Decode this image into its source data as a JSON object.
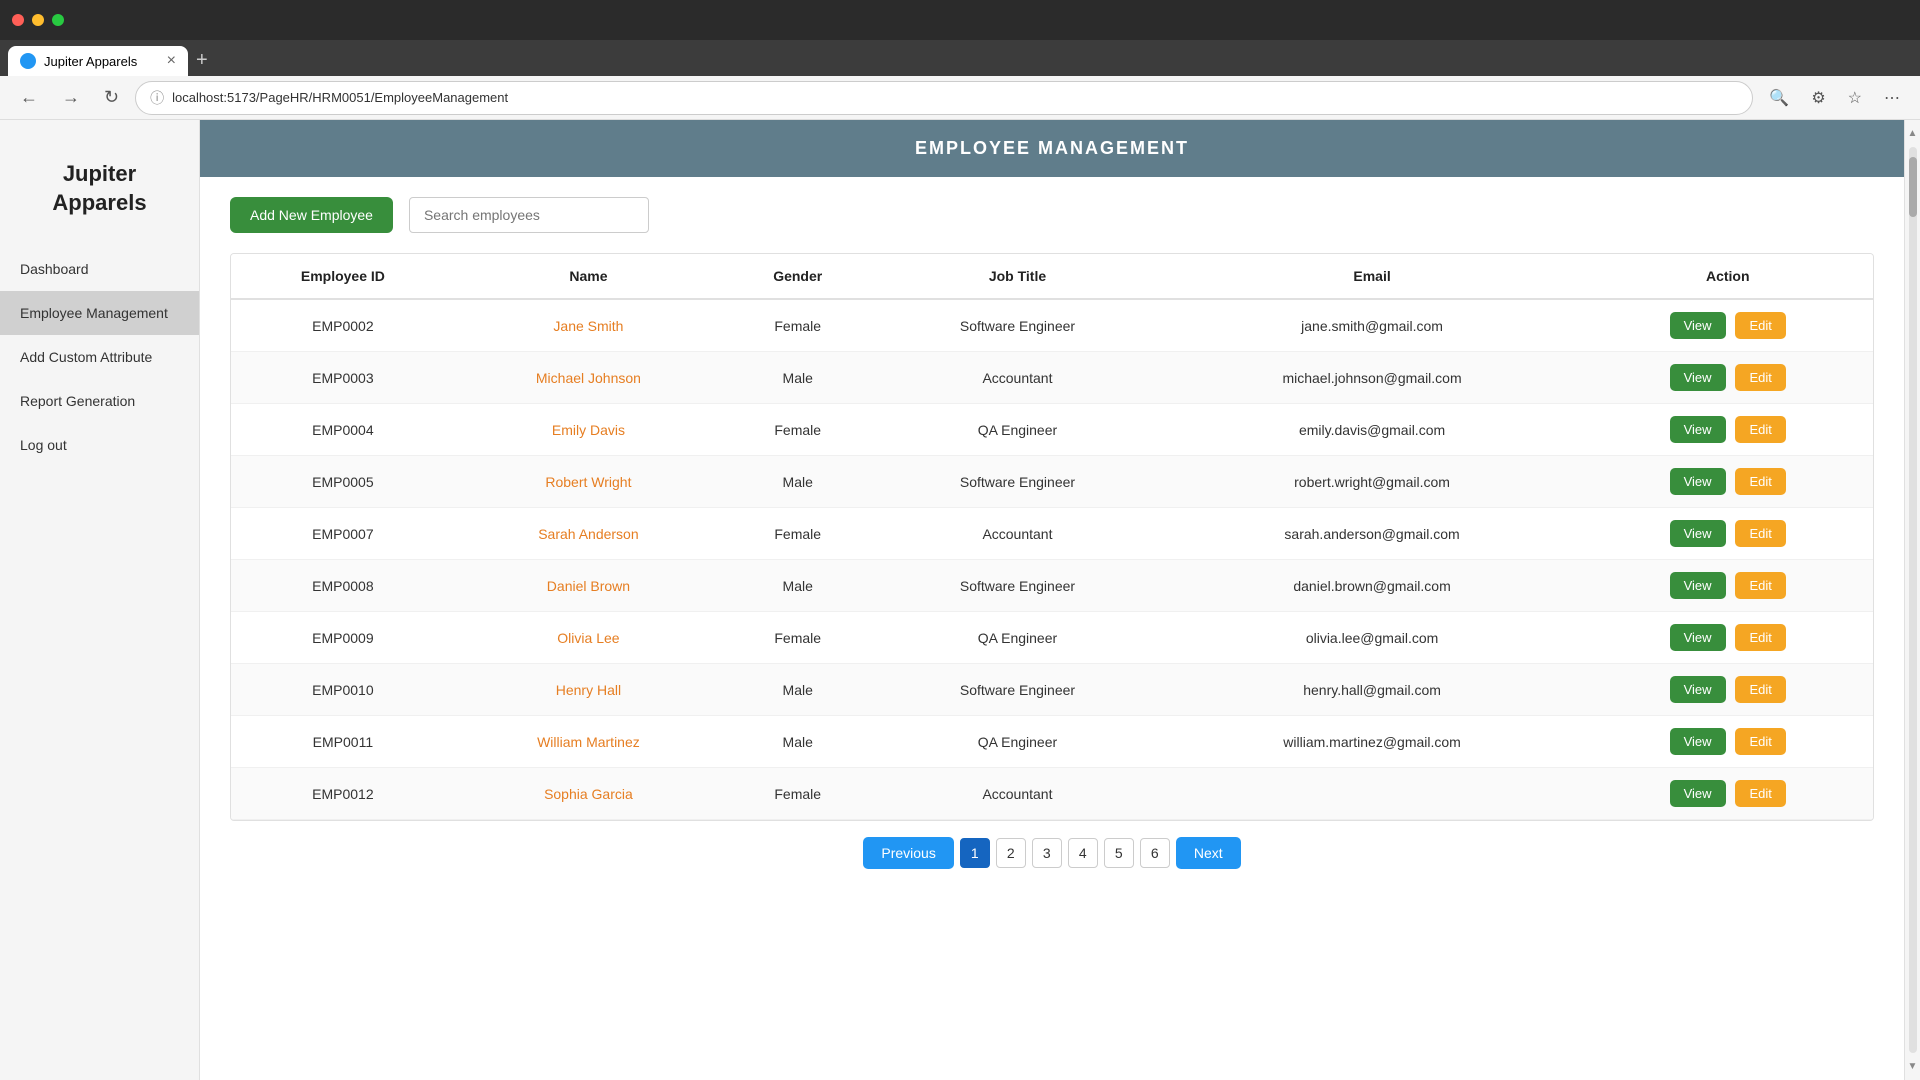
{
  "browser": {
    "tab_label": "Jupiter Apparels",
    "url": "localhost:5173/PageHR/HRM0051/EmployeeManagement",
    "new_tab_label": "+"
  },
  "sidebar": {
    "logo": "Jupiter Apparels",
    "items": [
      {
        "id": "dashboard",
        "label": "Dashboard",
        "active": false
      },
      {
        "id": "employee-management",
        "label": "Employee Management",
        "active": true
      },
      {
        "id": "add-custom-attribute",
        "label": "Add Custom Attribute",
        "active": false
      },
      {
        "id": "report-generation",
        "label": "Report Generation",
        "active": false
      },
      {
        "id": "log-out",
        "label": "Log out",
        "active": false
      }
    ]
  },
  "header": {
    "title": "EMPLOYEE MANAGEMENT"
  },
  "toolbar": {
    "add_button": "Add New Employee",
    "search_placeholder": "Search employees"
  },
  "table": {
    "columns": [
      "Employee ID",
      "Name",
      "Gender",
      "Job Title",
      "Email",
      "Action"
    ],
    "rows": [
      {
        "id": "EMP0002",
        "name": "Jane Smith",
        "gender": "Female",
        "job": "Software Engineer",
        "email": "jane.smith@gmail.com"
      },
      {
        "id": "EMP0003",
        "name": "Michael Johnson",
        "gender": "Male",
        "job": "Accountant",
        "email": "michael.johnson@gmail.com"
      },
      {
        "id": "EMP0004",
        "name": "Emily Davis",
        "gender": "Female",
        "job": "QA Engineer",
        "email": "emily.davis@gmail.com"
      },
      {
        "id": "EMP0005",
        "name": "Robert Wright",
        "gender": "Male",
        "job": "Software Engineer",
        "email": "robert.wright@gmail.com"
      },
      {
        "id": "EMP0007",
        "name": "Sarah Anderson",
        "gender": "Female",
        "job": "Accountant",
        "email": "sarah.anderson@gmail.com"
      },
      {
        "id": "EMP0008",
        "name": "Daniel Brown",
        "gender": "Male",
        "job": "Software Engineer",
        "email": "daniel.brown@gmail.com"
      },
      {
        "id": "EMP0009",
        "name": "Olivia Lee",
        "gender": "Female",
        "job": "QA Engineer",
        "email": "olivia.lee@gmail.com"
      },
      {
        "id": "EMP0010",
        "name": "Henry Hall",
        "gender": "Male",
        "job": "Software Engineer",
        "email": "henry.hall@gmail.com"
      },
      {
        "id": "EMP0011",
        "name": "William Martinez",
        "gender": "Male",
        "job": "QA Engineer",
        "email": "william.martinez@gmail.com"
      },
      {
        "id": "EMP0012",
        "name": "Sophia Garcia",
        "gender": "Female",
        "job": "Accountant",
        "email": ""
      }
    ],
    "action_view": "View",
    "action_edit": "Edit"
  },
  "pagination": {
    "prev_label": "Previous",
    "next_label": "Next",
    "pages": [
      "1",
      "2",
      "3",
      "4",
      "5",
      "6"
    ],
    "current_page": "1"
  }
}
